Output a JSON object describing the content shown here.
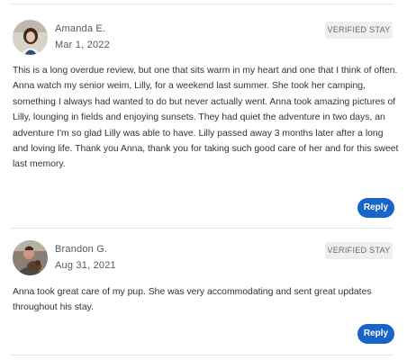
{
  "reviews": [
    {
      "name": "Amanda E.",
      "date": "Mar 1, 2022",
      "badge": "VERIFIED STAY",
      "paragraphs": [
        "This is a long overdue review, but one that sits warm in my heart and one that I think of often.",
        "Anna watch my senior weim, Lilly, for a weekend last summer. She took her camping, something I always had wanted to do but never actually went. Anna took amazing pictures of Lilly, lounging in fields and enjoying sunsets. They had quiet the adventure in two days, an adventure I'm so glad Lilly was able to have. Lilly passed away 3 months later after a long and loving life. Thank you Anna, thank you for taking such good care of her and for this sweet last memory."
      ],
      "reply_label": "Reply"
    },
    {
      "name": "Brandon G.",
      "date": "Aug 31, 2021",
      "badge": "VERIFIED STAY",
      "paragraphs": [
        "Anna took great care of my pup. She was very accommodating and sent great updates throughout his stay."
      ],
      "reply_label": "Reply"
    }
  ],
  "colors": {
    "reply_button": "#1864c8",
    "badge_bg": "#efefef",
    "divider": "#e6e6e6"
  }
}
